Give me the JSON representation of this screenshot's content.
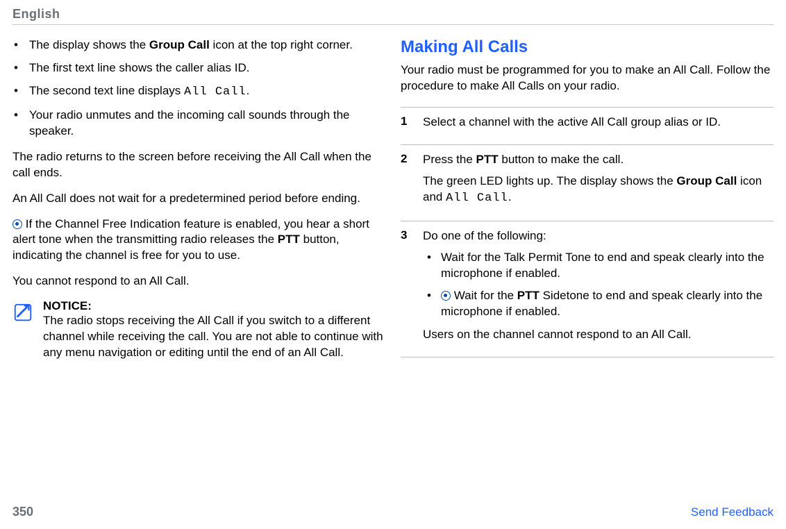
{
  "header": {
    "language": "English"
  },
  "left": {
    "bullets": [
      {
        "pre": "The display shows the ",
        "bold": "Group Call",
        "post": " icon at the top right corner."
      },
      {
        "pre": "The first text line shows the caller alias ID.",
        "bold": "",
        "post": ""
      },
      {
        "pre": "The second text line displays ",
        "mono": "All Call",
        "post": "."
      },
      {
        "pre": "Your radio unmutes and the incoming call sounds through the speaker.",
        "bold": "",
        "post": ""
      }
    ],
    "p1": "The radio returns to the screen before receiving the All Call when the call ends.",
    "p2": "An All Call does not wait for a predetermined period before ending.",
    "p3": {
      "pre": "If the Channel Free Indication feature is enabled, you hear a short alert tone when the transmitting radio releases the ",
      "bold": "PTT",
      "post": " button, indicating the channel is free for you to use."
    },
    "p4": "You cannot respond to an All Call.",
    "notice": {
      "label": "NOTICE:",
      "text": "The radio stops receiving the All Call if you switch to a different channel while receiving the call. You are not able to continue with any menu navigation or editing until the end of an All Call."
    }
  },
  "right": {
    "title": "Making All Calls",
    "intro": "Your radio must be programmed for you to make an All Call. Follow the procedure to make All Calls on your radio.",
    "steps": {
      "s1": {
        "num": "1",
        "text": "Select a channel with the active All Call group alias or ID."
      },
      "s2": {
        "num": "2",
        "line1_pre": "Press the ",
        "line1_bold": "PTT",
        "line1_post": " button to make the call.",
        "line2_pre": "The green LED lights up. The display shows the ",
        "line2_bold": "Group Call",
        "line2_mid": " icon and ",
        "line2_mono": "All Call",
        "line2_post": "."
      },
      "s3": {
        "num": "3",
        "intro": "Do one of the following:",
        "b1": "Wait for the Talk Permit Tone to end and speak clearly into the microphone if enabled.",
        "b2_pre": "Wait for the ",
        "b2_bold": "PTT",
        "b2_post": " Sidetone to end and speak clearly into the microphone if enabled.",
        "outro": "Users on the channel cannot respond to an All Call."
      }
    }
  },
  "footer": {
    "page": "350",
    "feedback": "Send Feedback"
  }
}
